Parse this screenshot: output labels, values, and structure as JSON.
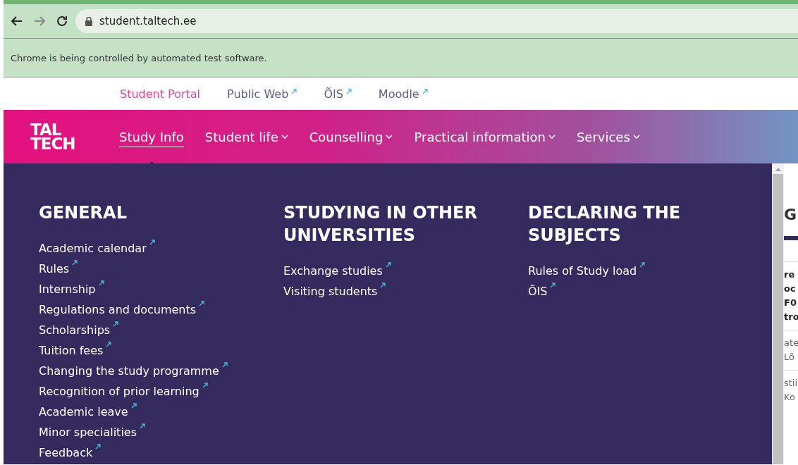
{
  "browser": {
    "url": "student.taltech.ee",
    "infobar": "Chrome is being controlled by automated test software."
  },
  "top_links": [
    {
      "label": "Student Portal",
      "selected": true,
      "external": false
    },
    {
      "label": "Public Web",
      "selected": false,
      "external": true
    },
    {
      "label": "ÕIS",
      "selected": false,
      "external": true
    },
    {
      "label": "Moodle",
      "selected": false,
      "external": true
    }
  ],
  "logo": [
    "TAL",
    "TECH"
  ],
  "nav": [
    {
      "label": "Study Info",
      "selected": true,
      "dropdown": false
    },
    {
      "label": "Student life",
      "selected": false,
      "dropdown": true
    },
    {
      "label": "Counselling",
      "selected": false,
      "dropdown": true
    },
    {
      "label": "Practical information",
      "selected": false,
      "dropdown": true
    },
    {
      "label": "Services",
      "selected": false,
      "dropdown": true
    }
  ],
  "menu_columns": [
    {
      "title": "GENERAL",
      "links": [
        "Academic calendar",
        "Rules",
        "Internship",
        "Regulations and documents",
        "Scholarships",
        "Tuition fees",
        "Changing the study programme",
        "Recognition of prior learning",
        "Academic leave",
        "Minor specialities",
        "Feedback"
      ]
    },
    {
      "title": "STUDYING IN OTHER UNIVERSITIES",
      "links": [
        "Exchange studies",
        "Visiting students"
      ]
    },
    {
      "title": "DECLARING THE SUBJECTS",
      "links": [
        "Rules of Study load",
        "ÕIS"
      ]
    }
  ],
  "background_page": {
    "heading": "G",
    "blocks": [
      {
        "bold": true,
        "lines": [
          "re",
          "oc",
          "F0",
          "tro"
        ]
      },
      {
        "bold": false,
        "lines": [
          "ate",
          "Lõ"
        ]
      },
      {
        "bold": false,
        "lines": [
          "stii",
          "Ko"
        ]
      }
    ]
  }
}
